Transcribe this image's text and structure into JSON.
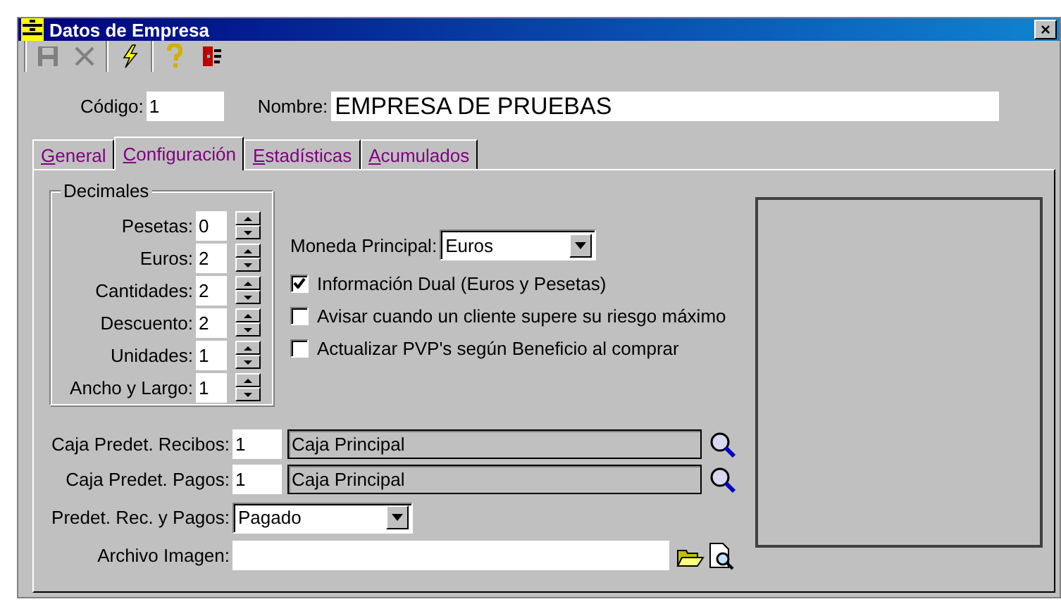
{
  "window": {
    "title": "Datos de Empresa",
    "close": "×"
  },
  "toolbar": [
    {
      "kind": "save",
      "disabled": true
    },
    {
      "kind": "delete",
      "disabled": true
    },
    {
      "kind": "separator"
    },
    {
      "kind": "bolt",
      "disabled": false
    },
    {
      "kind": "separator"
    },
    {
      "kind": "help",
      "disabled": false
    },
    {
      "kind": "exit",
      "disabled": false
    }
  ],
  "header": {
    "code_label": "Código:",
    "code": "1",
    "name_label": "Nombre:",
    "name": "EMPRESA DE PRUEBAS"
  },
  "tabs": [
    {
      "label": "General",
      "selected": false
    },
    {
      "label": "Configuración",
      "selected": true
    },
    {
      "label": "Estadísticas",
      "selected": false
    },
    {
      "label": "Acumulados",
      "selected": false
    }
  ],
  "decimales": {
    "title": "Decimales",
    "rows": [
      {
        "label": "Pesetas:",
        "value": "0"
      },
      {
        "label": "Euros:",
        "value": "2"
      },
      {
        "label": "Cantidades:",
        "value": "2"
      },
      {
        "label": "Descuento:",
        "value": "2"
      },
      {
        "label": "Unidades:",
        "value": "1"
      },
      {
        "label": "Ancho y Largo:",
        "value": "1"
      }
    ]
  },
  "moneda": {
    "label": "Moneda Principal:",
    "value": "Euros"
  },
  "options": [
    {
      "label": "Información Dual (Euros y Pesetas)",
      "checked": true
    },
    {
      "label": "Avisar cuando un cliente supere su riesgo máximo",
      "checked": false
    },
    {
      "label": "Actualizar PVP's según Beneficio al comprar",
      "checked": false
    }
  ],
  "cajas": [
    {
      "label": "Caja Predet. Recibos:",
      "code": "1",
      "name": "Caja Principal"
    },
    {
      "label": "Caja Predet. Pagos:",
      "code": "1",
      "name": "Caja Principal"
    }
  ],
  "estado": {
    "label": "Predet. Rec. y Pagos:",
    "value": "Pagado"
  },
  "archivo": {
    "label": "Archivo Imagen:"
  }
}
